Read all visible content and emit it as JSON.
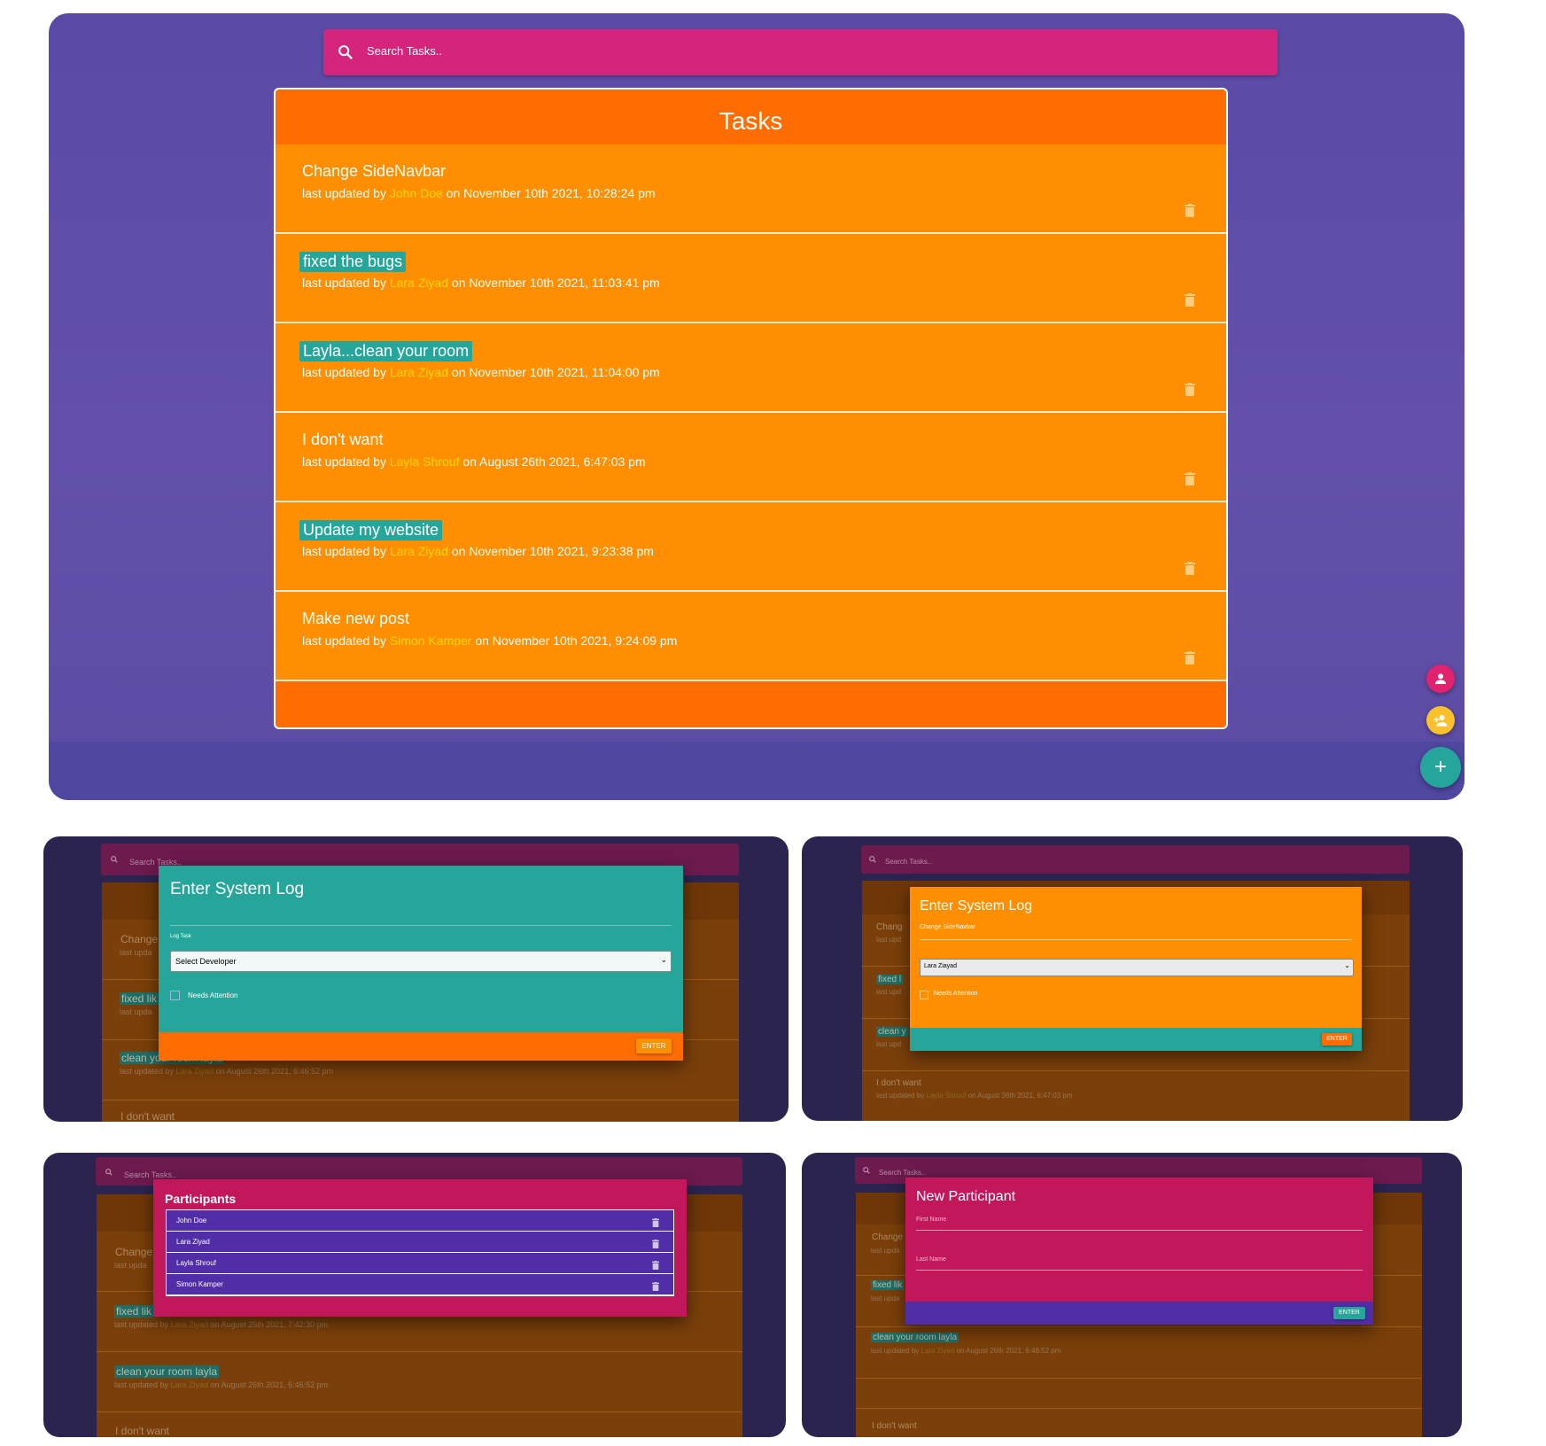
{
  "search": {
    "placeholder": "Search Tasks.."
  },
  "tasks_title": "Tasks",
  "tasks": [
    {
      "name": "Change SideNavbar",
      "prefix": "last updated by ",
      "user": "John Doe",
      "suffix": " on November 10th 2021, 10:28:24 pm",
      "highlighted": false
    },
    {
      "name": "fixed the bugs",
      "prefix": "last updated by ",
      "user": "Lara Ziyad",
      "suffix": " on November 10th 2021, 11:03:41 pm",
      "highlighted": true
    },
    {
      "name": "Layla...clean your room",
      "prefix": "last updated by ",
      "user": "Lara Ziyad",
      "suffix": " on November 10th 2021, 11:04:00 pm",
      "highlighted": true
    },
    {
      "name": "I don't want",
      "prefix": "last updated by ",
      "user": "Layla Shrouf",
      "suffix": " on August 26th 2021, 6:47:03 pm",
      "highlighted": false
    },
    {
      "name": "Update my website",
      "prefix": "last updated by ",
      "user": "Lara Ziyad",
      "suffix": " on November 10th 2021, 9:23:38 pm",
      "highlighted": true
    },
    {
      "name": "Make new post",
      "prefix": "last updated by ",
      "user": "Simon Kamper",
      "suffix": " on November 10th 2021, 9:24:09 pm",
      "highlighted": false
    }
  ],
  "fabs": {
    "add": "+"
  },
  "icons": [
    "search-icon",
    "trash-icon",
    "person-icon",
    "person-add-icon",
    "plus-icon"
  ],
  "colors": {
    "accent_pink": "#d4247b",
    "task_orange": "#ff8f00",
    "header_orange": "#ff6d00",
    "teal": "#26a69a",
    "user_yellow": "#ffd600",
    "purple": "#512da8"
  },
  "panel1": {
    "search": "Search Tasks..",
    "bg_tasks": [
      "Change",
      "fixed lik",
      "clean your room layla",
      "I don't want"
    ],
    "bg_meta": [
      "last upda",
      "last upda"
    ],
    "bg_meta3": {
      "prefix": "last updated by ",
      "user": "Lara Ziyad",
      "suffix": " on August 26th 2021, 6:46:52 pm"
    },
    "modal": {
      "title": "Enter System Log",
      "field_label": "Log Task",
      "select_value": "Select Developer",
      "checkbox_label": "Needs Attention",
      "enter": "ENTER"
    }
  },
  "panel2": {
    "search": "Search Tasks..",
    "bg_tasks": [
      "Chang",
      "fixed l",
      "clean y",
      "I don't want"
    ],
    "bg_meta": [
      "last upd",
      "last upd",
      "last upd"
    ],
    "bg_meta4": {
      "prefix": "last updated by ",
      "user": "Layla Shrouf",
      "suffix": " on August 26th 2021, 6:47:03 pm"
    },
    "modal": {
      "title": "Enter System Log",
      "field_value": "Change SideNavbar",
      "select_value": "Lara Ziayad",
      "checkbox_label": "Needs Attention",
      "enter": "ENTER"
    }
  },
  "panel3": {
    "search": "Search Tasks..",
    "bg_tasks": [
      "Change",
      "fixed lik",
      "clean your room layla",
      "I don't want"
    ],
    "bg_meta": [
      "last upda"
    ],
    "bg_meta2": {
      "prefix": "last updated by ",
      "user": "Lara Ziyad",
      "suffix": " on August 25th 2021, 7:42:30 pm"
    },
    "bg_meta3": {
      "prefix": "last updated by ",
      "user": "Lara Ziyad",
      "suffix": " on August 26th 2021, 6:46:52 pm"
    },
    "modal": {
      "title": "Participants",
      "participants": [
        "John Doe",
        "Lara Ziyad",
        "Layla Shrouf",
        "Simon Kamper"
      ]
    }
  },
  "panel4": {
    "search": "Search Tasks..",
    "bg_tasks": [
      "Change",
      "fixed lik",
      "clean your room layla",
      "I don't want"
    ],
    "bg_meta": [
      "last upda",
      "last upda"
    ],
    "bg_meta3": {
      "prefix": "last updated by ",
      "user": "Lara Ziyad",
      "suffix": " on August 26th 2021, 6:46:52 pm"
    },
    "modal": {
      "title": "New Participant",
      "first_label": "First Name",
      "last_label": "Last Name",
      "enter": "ENTER"
    }
  }
}
